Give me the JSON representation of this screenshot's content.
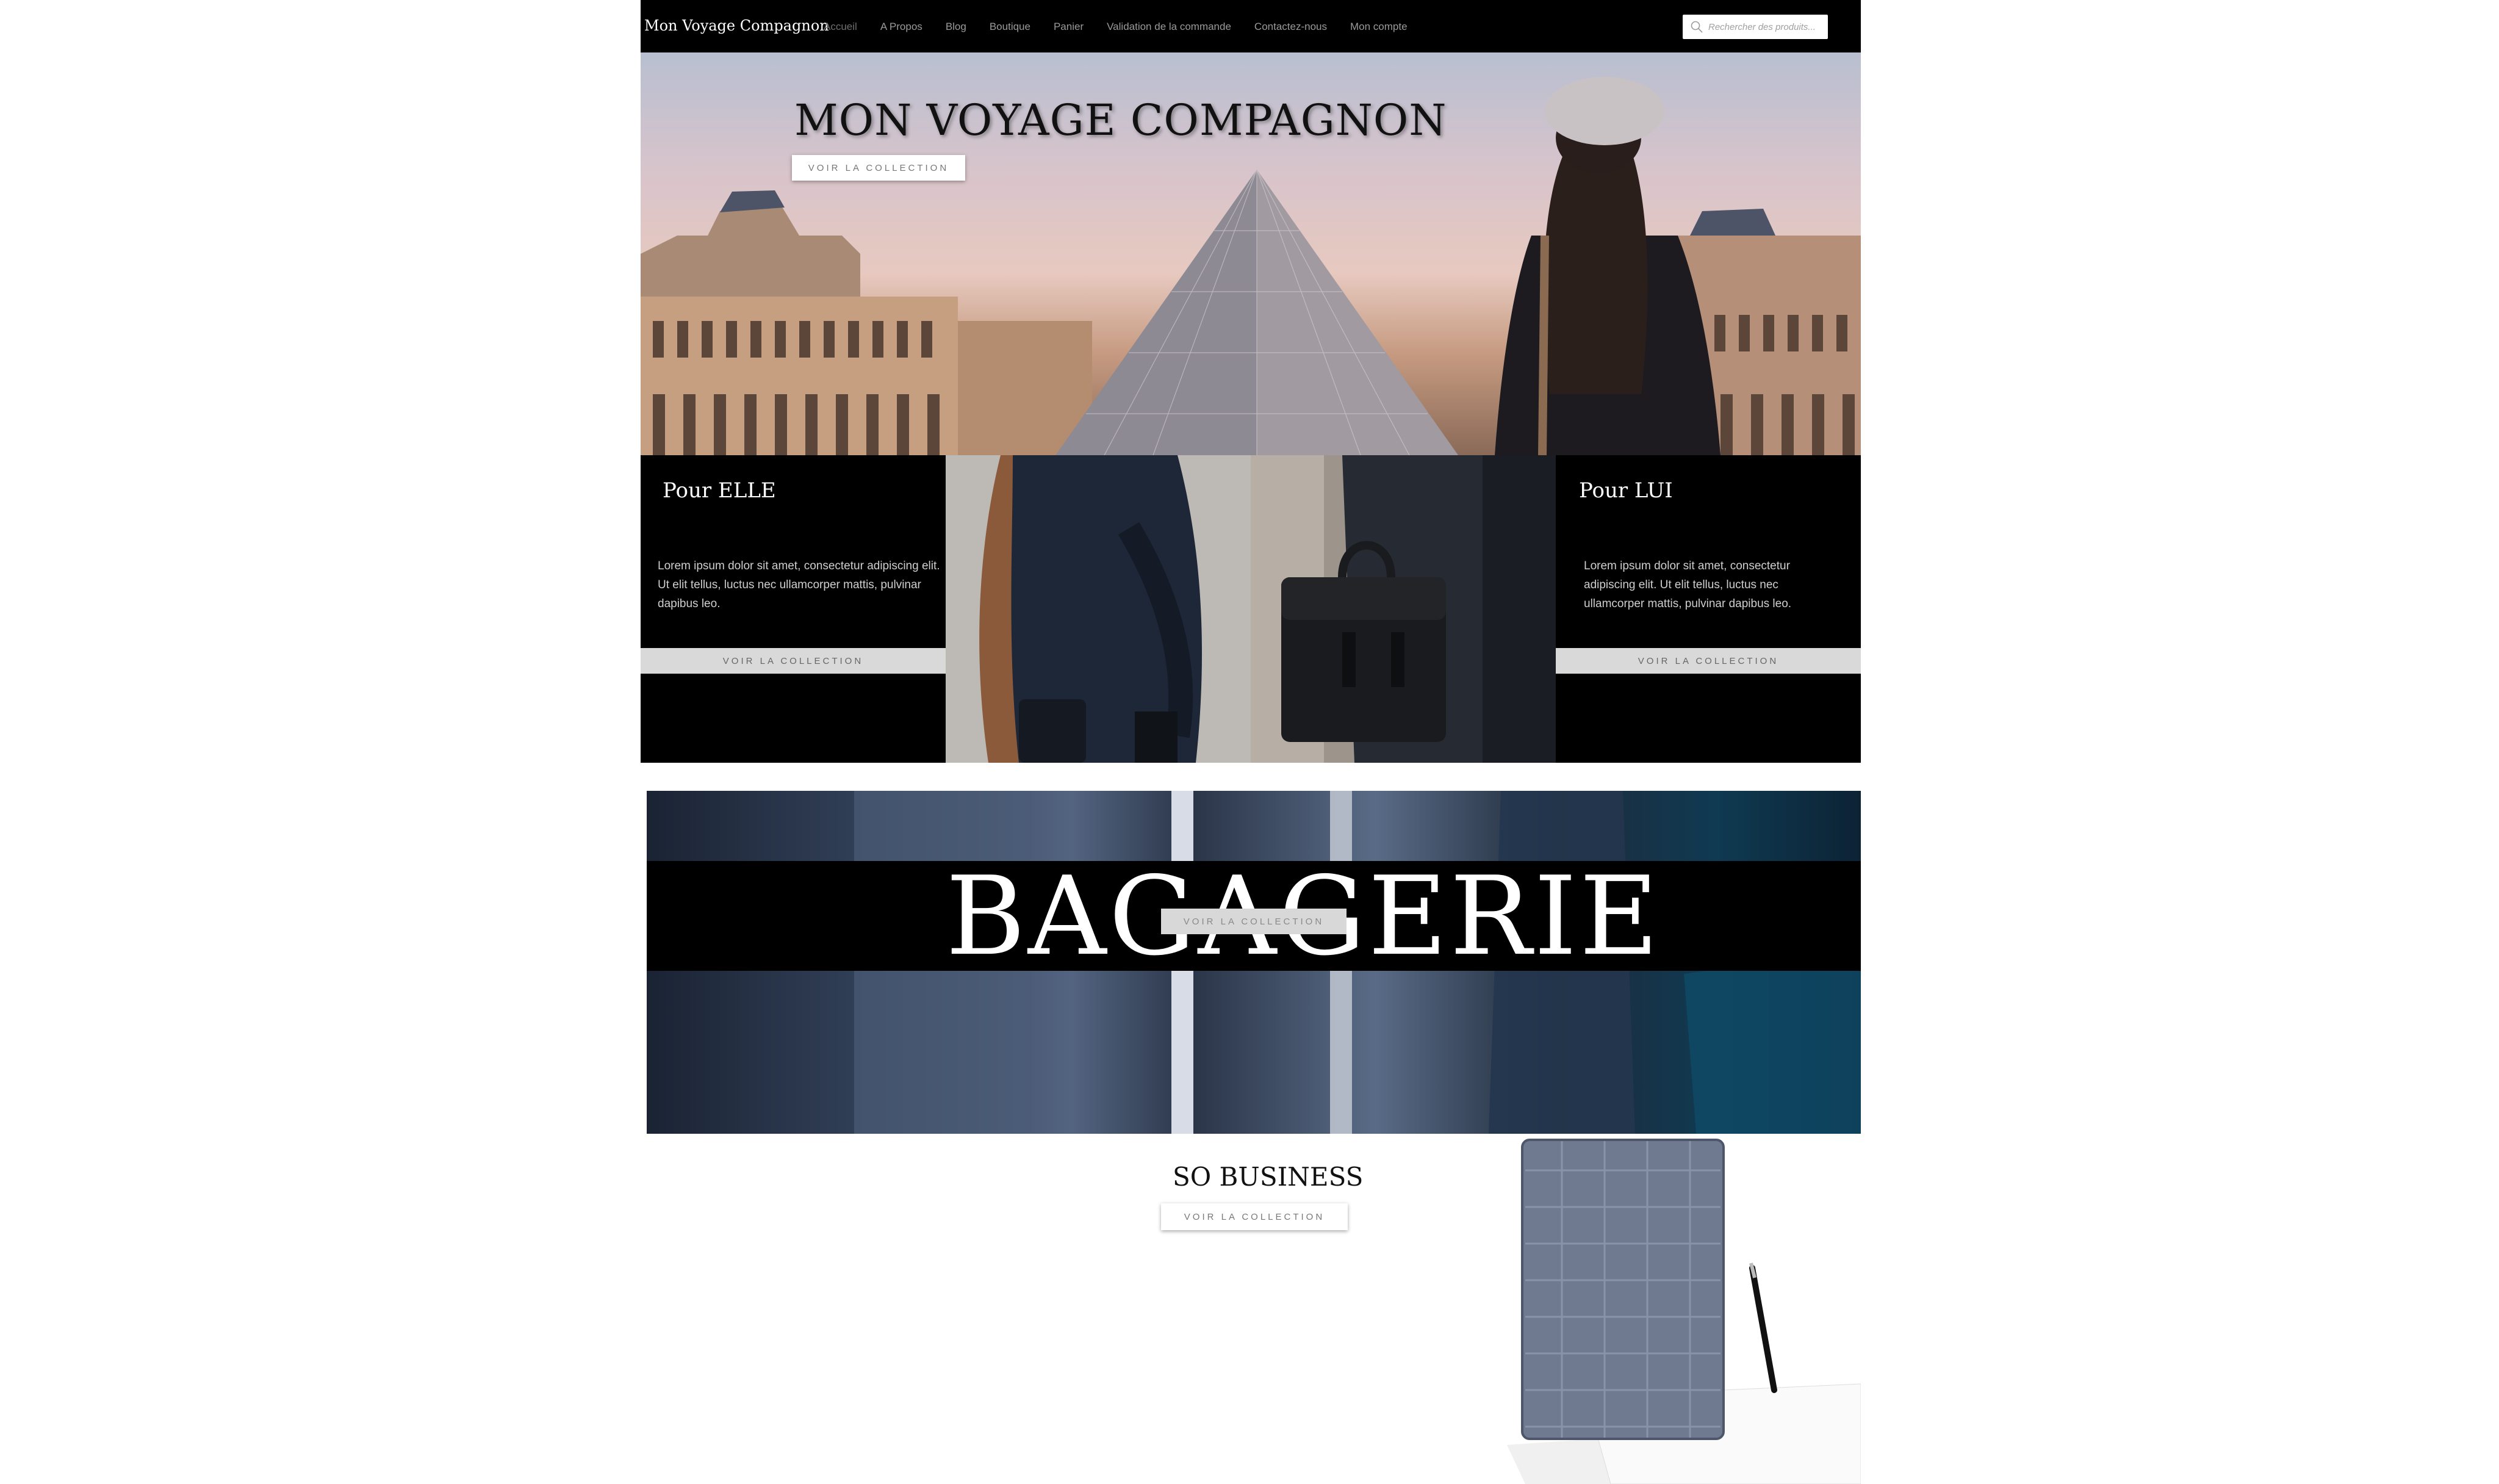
{
  "nav": {
    "brand": "Mon Voyage Compagnon",
    "items": [
      {
        "label": "Accueil"
      },
      {
        "label": "A Propos"
      },
      {
        "label": "Blog"
      },
      {
        "label": "Boutique"
      },
      {
        "label": "Panier"
      },
      {
        "label": "Validation de la commande"
      },
      {
        "label": "Contactez-nous"
      },
      {
        "label": "Mon compte"
      }
    ],
    "search_placeholder": "Rechercher des produits..."
  },
  "hero": {
    "title": "MON VOYAGE COMPAGNON",
    "button": "VOIR LA COLLECTION"
  },
  "her": {
    "title": "Pour ELLE",
    "text": "Lorem ipsum dolor sit amet, consectetur adipiscing elit. Ut elit tellus, luctus nec ullamcorper mattis, pulvinar dapibus leo.",
    "button": "VOIR LA COLLECTION"
  },
  "him": {
    "title": "Pour LUI",
    "text": "Lorem ipsum dolor sit amet, consectetur adipiscing elit. Ut elit tellus, luctus nec ullamcorper mattis, pulvinar dapibus leo.",
    "button": "VOIR LA COLLECTION"
  },
  "bagagerie": {
    "title": "BAGAGERIE",
    "button": "VOIR LA COLLECTION"
  },
  "business": {
    "title": "SO BUSINESS",
    "button": "VOIR LA COLLECTION"
  }
}
